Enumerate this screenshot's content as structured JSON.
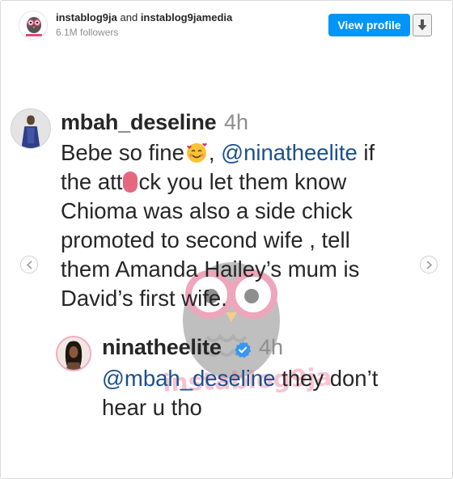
{
  "header": {
    "account_primary": "instablog9ja",
    "and_text": "and",
    "account_secondary": "instablog9jamedia",
    "followers": "6.1M followers",
    "view_profile_label": "View profile",
    "avatar_icon": "instablog9ja-logo-icon",
    "download_icon": "arrow-down-icon"
  },
  "post": {
    "comments": [
      {
        "username": "mbah_deseline",
        "time": "4h",
        "lines": {
          "l1_a": "Bebe so fine",
          "l1_b": ", ",
          "l1_mention": "@ninatheelite",
          "l1_c": " if",
          "l2_a": "the att",
          "l2_b": "ck you let them know",
          "l3": "Chioma was also a side chick",
          "l4": "promoted to second wife , tell",
          "l5": "them Amanda Hailey’s mum is",
          "l6": "David’s first wife."
        }
      },
      {
        "username": "ninatheelite",
        "time": "4h",
        "verified": true,
        "lines": {
          "l1_mention": "@mbah_deseline",
          "l1_b": " they don’t",
          "l2": "hear u tho"
        }
      }
    ],
    "watermark_text": "instablog9ja",
    "nav_prev_icon": "chevron-left-icon",
    "nav_next_icon": "chevron-right-icon"
  },
  "colors": {
    "accent": "#0095f6",
    "mention": "#1b4f8c",
    "muted": "#8e8e8e",
    "censor": "#e5677e"
  }
}
